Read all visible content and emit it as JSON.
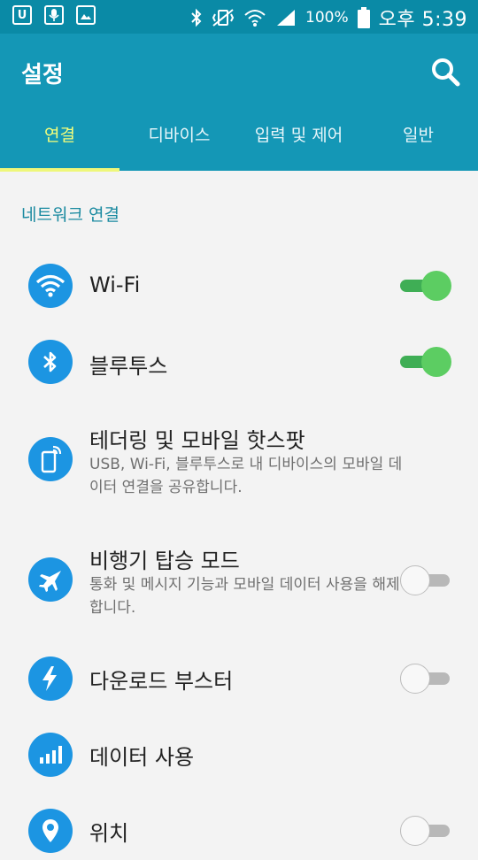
{
  "status_bar": {
    "notif_u": "U",
    "battery": "100%",
    "time": "오후 5:39",
    "icons": [
      "u-app-icon",
      "mic-icon",
      "image-icon",
      "bluetooth-icon",
      "vibrate-icon",
      "wifi-icon",
      "signal-icon",
      "battery-icon"
    ]
  },
  "header": {
    "title": "설정"
  },
  "tabs": [
    {
      "label": "연결",
      "active": true
    },
    {
      "label": "디바이스",
      "active": false
    },
    {
      "label": "입력 및 제어",
      "active": false
    },
    {
      "label": "일반",
      "active": false
    }
  ],
  "section": {
    "header": "네트워크 연결"
  },
  "items": [
    {
      "title": "Wi-Fi",
      "icon": "wifi-icon",
      "toggle": true
    },
    {
      "title": "블루투스",
      "icon": "bluetooth-icon",
      "toggle": true
    },
    {
      "title": "테더링 및 모바일 핫스팟",
      "subtitle": "USB, Wi-Fi, 블루투스로 내 디바이스의 모바일 데이터 연결을 공유합니다.",
      "icon": "tethering-icon"
    },
    {
      "title": "비행기 탑승 모드",
      "subtitle": "통화 및 메시지 기능과 모바일 데이터 사용을 해제합니다.",
      "icon": "airplane-icon",
      "toggle": false
    },
    {
      "title": "다운로드 부스터",
      "icon": "download-booster-icon",
      "toggle": false
    },
    {
      "title": "데이터 사용",
      "icon": "data-usage-icon"
    },
    {
      "title": "위치",
      "icon": "location-icon",
      "toggle": false
    }
  ],
  "colors": {
    "status_bar": "#0a8aa6",
    "app_bar": "#1497b6",
    "active_tab": "#f6ff7a",
    "icon_circle": "#1c95e2",
    "toggle_on": "#5ccd62",
    "section_header": "#1a8aa0"
  }
}
